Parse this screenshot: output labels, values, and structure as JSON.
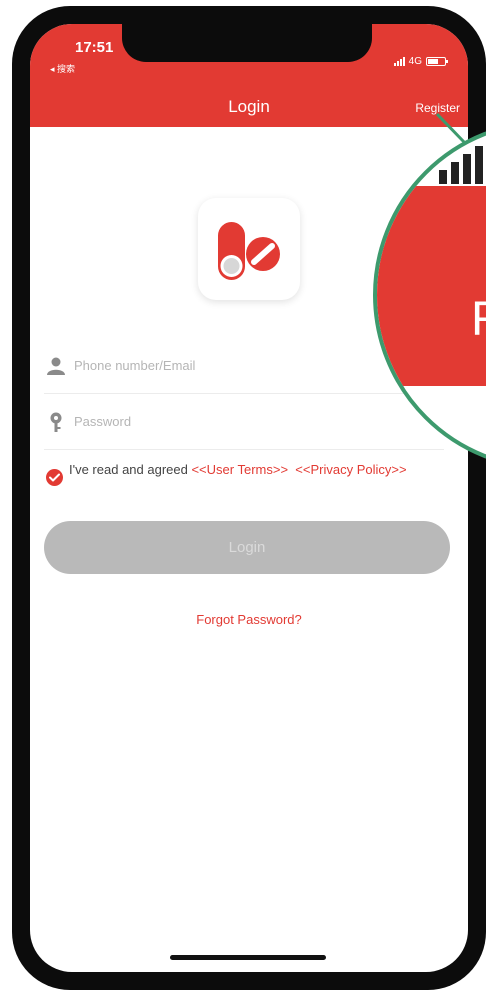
{
  "status_bar": {
    "time": "17:51",
    "back_label": "◂ 搜索",
    "network": "4G"
  },
  "header": {
    "title": "Login",
    "register_label": "Register"
  },
  "form": {
    "phone_placeholder": "Phone number/Email",
    "password_placeholder": "Password",
    "agree_text": "I've read and agreed ",
    "user_terms": "<<User Terms>>",
    "privacy_policy": "<<Privacy Policy>>",
    "agree_checked": true,
    "login_label": "Login",
    "forgot_label": "Forgot Password?"
  },
  "magnifier": {
    "zoomed_text": "R"
  },
  "colors": {
    "accent": "#e23a33",
    "callout": "#3d9a6d",
    "button_disabled": "#b9b9b9"
  },
  "icons": [
    "user-icon",
    "key-icon",
    "check-circle-icon",
    "app-logo",
    "signal-icon",
    "battery-icon"
  ]
}
